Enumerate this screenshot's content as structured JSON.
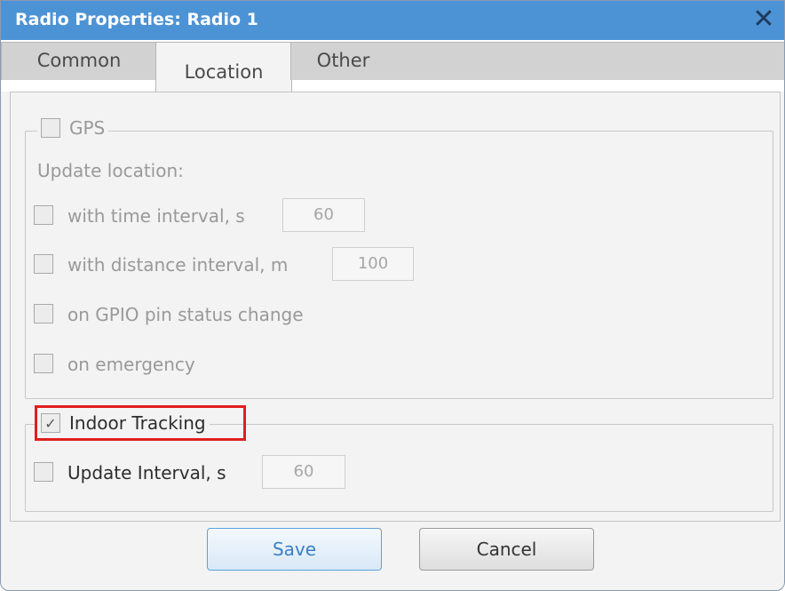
{
  "window": {
    "title": "Radio Properties: Radio 1"
  },
  "tabs": [
    {
      "label": "Common",
      "active": false
    },
    {
      "label": "Location",
      "active": true
    },
    {
      "label": "Other",
      "active": false
    }
  ],
  "gps": {
    "label": "GPS",
    "checked": false,
    "update_location_label": "Update location:",
    "time_interval": {
      "label": "with time interval, s",
      "value": "60",
      "checked": false
    },
    "distance_interval": {
      "label": "with distance interval, m",
      "value": "100",
      "checked": false
    },
    "gpio": {
      "label": "on GPIO pin status change",
      "checked": false
    },
    "emergency": {
      "label": "on emergency",
      "checked": false
    }
  },
  "indoor_tracking": {
    "label": "Indoor Tracking",
    "checked": true,
    "update_interval": {
      "label": "Update Interval, s",
      "value": "60",
      "checked": false
    }
  },
  "buttons": {
    "save": "Save",
    "cancel": "Cancel"
  },
  "icons": {
    "close": "close-icon",
    "checkmark": "checkmark-icon"
  },
  "colors": {
    "title_bar": "#4c93d5",
    "highlight": "#e11e1e",
    "save_text": "#3b7fc4"
  }
}
